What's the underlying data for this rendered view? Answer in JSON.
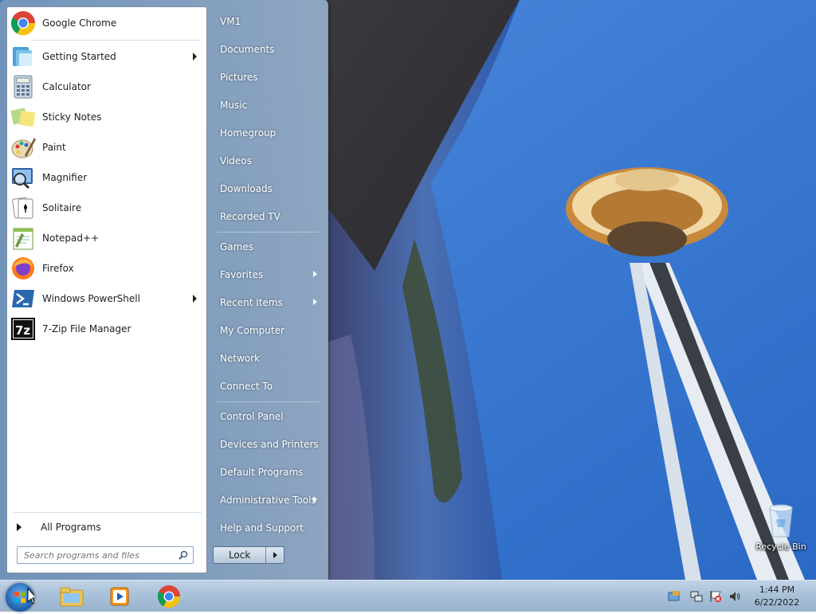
{
  "start_menu": {
    "programs": [
      {
        "label": "Google Chrome",
        "icon": "chrome-icon",
        "has_submenu": false
      },
      {
        "label": "Getting Started",
        "icon": "getting-started-icon",
        "has_submenu": true
      },
      {
        "label": "Calculator",
        "icon": "calculator-icon",
        "has_submenu": false
      },
      {
        "label": "Sticky Notes",
        "icon": "sticky-notes-icon",
        "has_submenu": false
      },
      {
        "label": "Paint",
        "icon": "paint-icon",
        "has_submenu": false
      },
      {
        "label": "Magnifier",
        "icon": "magnifier-icon",
        "has_submenu": false
      },
      {
        "label": "Solitaire",
        "icon": "solitaire-icon",
        "has_submenu": false
      },
      {
        "label": "Notepad++",
        "icon": "notepadpp-icon",
        "has_submenu": false
      },
      {
        "label": "Firefox",
        "icon": "firefox-icon",
        "has_submenu": false
      },
      {
        "label": "Windows PowerShell",
        "icon": "powershell-icon",
        "has_submenu": true
      },
      {
        "label": "7-Zip File Manager",
        "icon": "7zip-icon",
        "has_submenu": false
      }
    ],
    "all_programs_label": "All Programs",
    "search_placeholder": "Search programs and files",
    "places": [
      {
        "label": "VM1",
        "has_submenu": false
      },
      {
        "label": "Documents",
        "has_submenu": false
      },
      {
        "label": "Pictures",
        "has_submenu": false
      },
      {
        "label": "Music",
        "has_submenu": false
      },
      {
        "label": "Homegroup",
        "has_submenu": false
      },
      {
        "label": "Videos",
        "has_submenu": false
      },
      {
        "label": "Downloads",
        "has_submenu": false
      },
      {
        "label": "Recorded TV",
        "has_submenu": false
      },
      {
        "label": "Games",
        "has_submenu": false
      },
      {
        "label": "Favorites",
        "has_submenu": true
      },
      {
        "label": "Recent Items",
        "has_submenu": true
      },
      {
        "label": "My Computer",
        "has_submenu": false
      },
      {
        "label": "Network",
        "has_submenu": false
      },
      {
        "label": "Connect To",
        "has_submenu": false
      },
      {
        "label": "Control Panel",
        "has_submenu": false
      },
      {
        "label": "Devices and Printers",
        "has_submenu": false
      },
      {
        "label": "Default Programs",
        "has_submenu": false
      },
      {
        "label": "Administrative Tools",
        "has_submenu": true
      },
      {
        "label": "Help and Support",
        "has_submenu": false
      }
    ],
    "lock_label": "Lock"
  },
  "desktop": {
    "recycle_bin_label": "Recycle Bin"
  },
  "taskbar": {
    "pinned": [
      "explorer-icon",
      "media-player-icon",
      "chrome-icon"
    ],
    "clock_time": "1:44 PM",
    "clock_date": "6/22/2022",
    "tray_icons": [
      "action-center-icon",
      "network-icon",
      "flag-icon",
      "volume-icon"
    ]
  }
}
